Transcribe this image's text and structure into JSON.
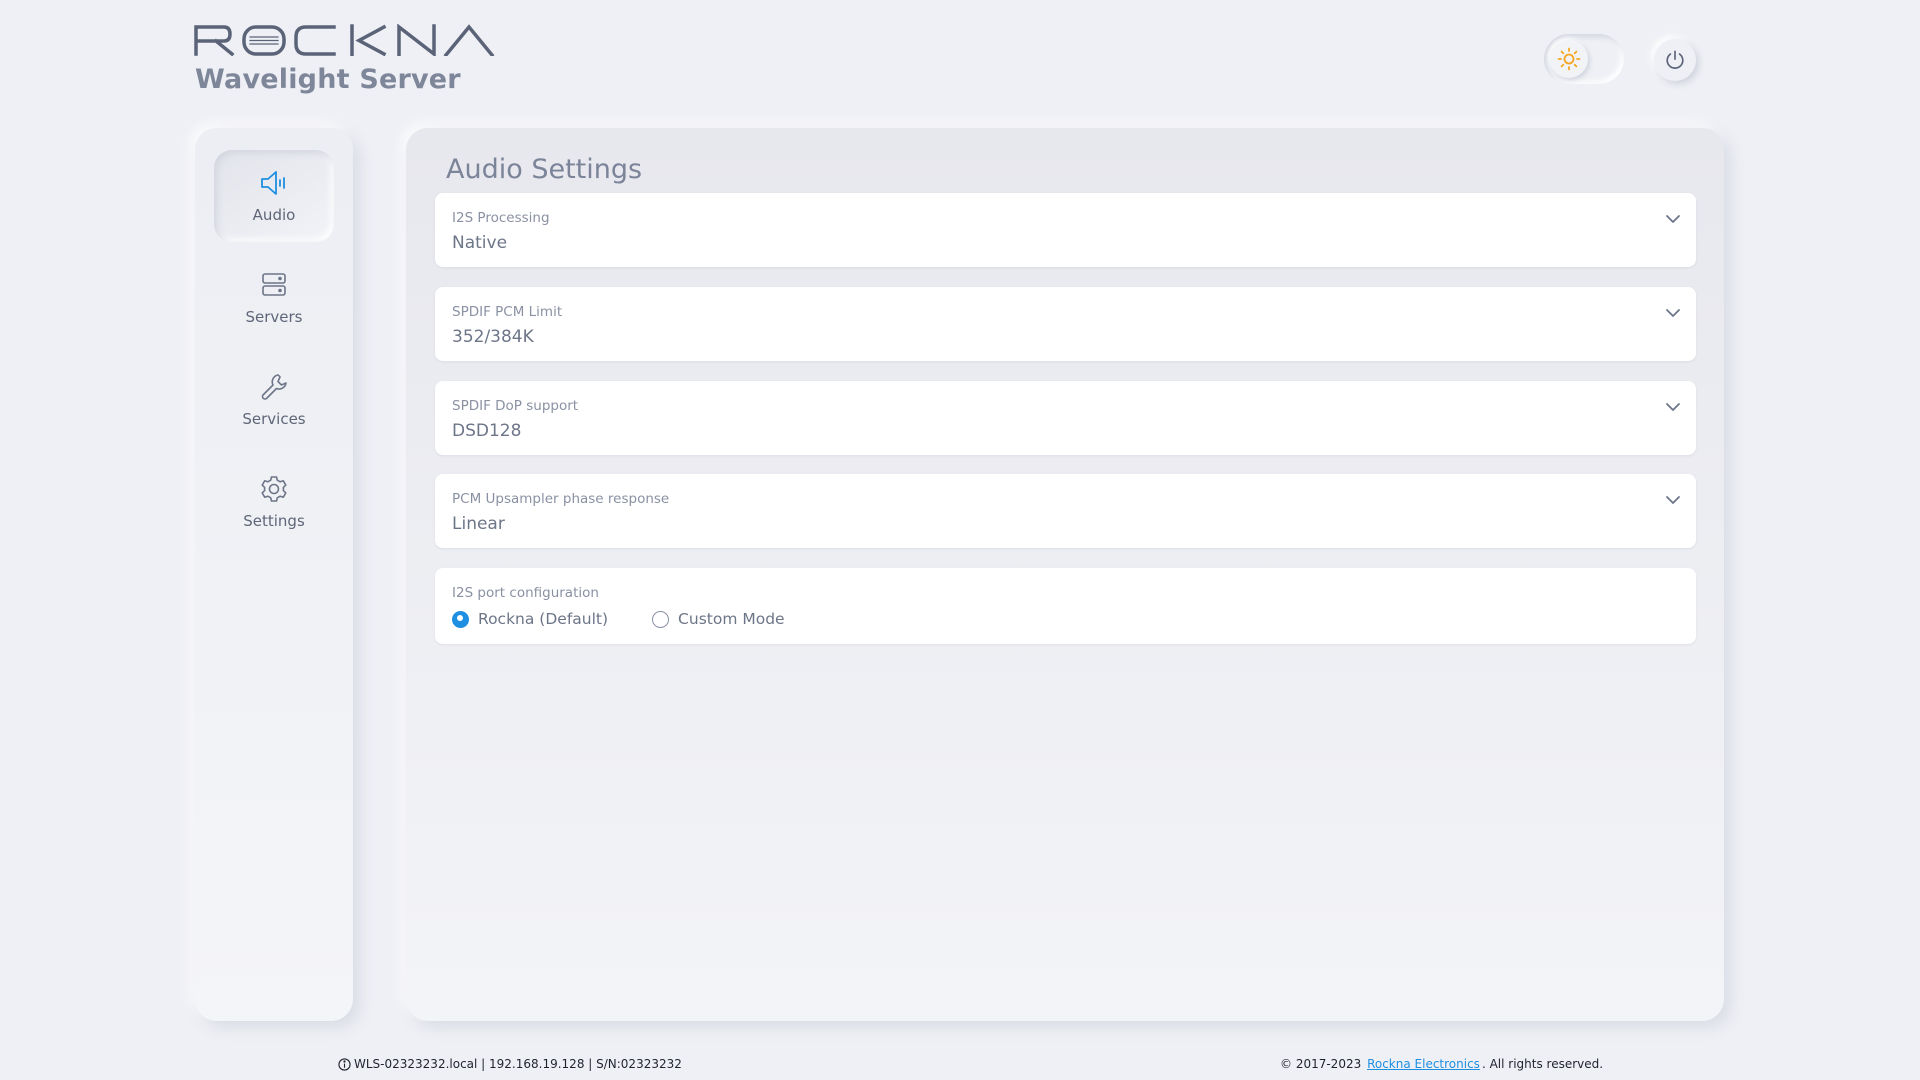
{
  "brand": {
    "logo_text": "ROCKNA",
    "subtitle": "Wavelight Server"
  },
  "header": {
    "theme_toggle_state": "light",
    "theme_icon": "sun-icon",
    "power_icon": "power-icon"
  },
  "sidebar": {
    "items": [
      {
        "label": "Audio",
        "icon": "speaker-icon",
        "active": true
      },
      {
        "label": "Servers",
        "icon": "server-icon",
        "active": false
      },
      {
        "label": "Services",
        "icon": "wrench-icon",
        "active": false
      },
      {
        "label": "Settings",
        "icon": "gear-icon",
        "active": false
      }
    ]
  },
  "main": {
    "title": "Audio Settings",
    "settings": [
      {
        "label": "I2S Processing",
        "value": "Native"
      },
      {
        "label": "SPDIF PCM Limit",
        "value": "352/384K"
      },
      {
        "label": "SPDIF DoP support",
        "value": "DSD128"
      },
      {
        "label": "PCM Upsampler phase response",
        "value": "Linear"
      }
    ],
    "port_config": {
      "label": "I2S port configuration",
      "options": [
        {
          "label": "Rockna (Default)",
          "checked": true
        },
        {
          "label": "Custom Mode",
          "checked": false
        }
      ]
    }
  },
  "footer": {
    "device_info": "WLS-02323232.local | 192.168.19.128 | S/N:02323232",
    "copyright_prefix": "© 2017-2023",
    "company_link": "Rockna Electronics",
    "copyright_suffix": ". All rights reserved."
  },
  "colors": {
    "accent": "#1e8fe1",
    "sun": "#f5a623",
    "background": "#eff0f5"
  }
}
